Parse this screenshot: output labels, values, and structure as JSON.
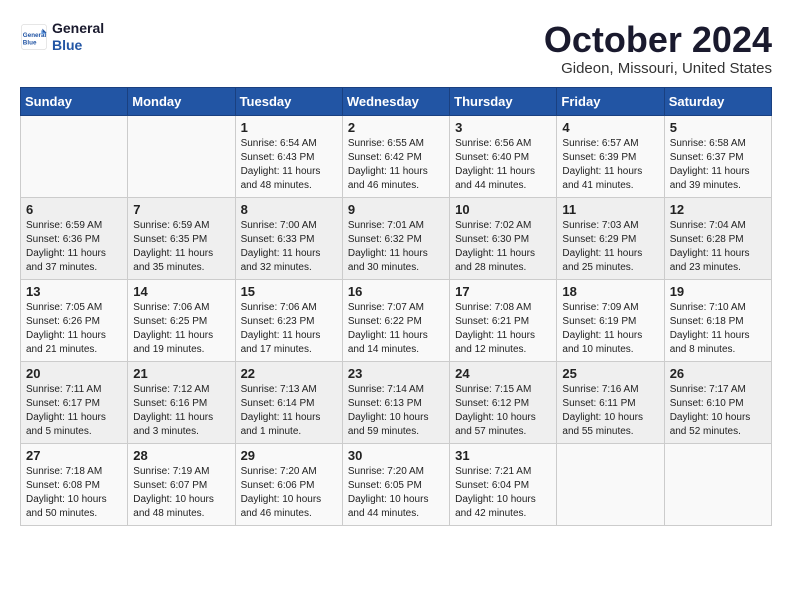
{
  "logo": {
    "line1": "General",
    "line2": "Blue"
  },
  "title": "October 2024",
  "location": "Gideon, Missouri, United States",
  "days_of_week": [
    "Sunday",
    "Monday",
    "Tuesday",
    "Wednesday",
    "Thursday",
    "Friday",
    "Saturday"
  ],
  "weeks": [
    [
      {
        "day": "",
        "content": ""
      },
      {
        "day": "",
        "content": ""
      },
      {
        "day": "1",
        "content": "Sunrise: 6:54 AM\nSunset: 6:43 PM\nDaylight: 11 hours and 48 minutes."
      },
      {
        "day": "2",
        "content": "Sunrise: 6:55 AM\nSunset: 6:42 PM\nDaylight: 11 hours and 46 minutes."
      },
      {
        "day": "3",
        "content": "Sunrise: 6:56 AM\nSunset: 6:40 PM\nDaylight: 11 hours and 44 minutes."
      },
      {
        "day": "4",
        "content": "Sunrise: 6:57 AM\nSunset: 6:39 PM\nDaylight: 11 hours and 41 minutes."
      },
      {
        "day": "5",
        "content": "Sunrise: 6:58 AM\nSunset: 6:37 PM\nDaylight: 11 hours and 39 minutes."
      }
    ],
    [
      {
        "day": "6",
        "content": "Sunrise: 6:59 AM\nSunset: 6:36 PM\nDaylight: 11 hours and 37 minutes."
      },
      {
        "day": "7",
        "content": "Sunrise: 6:59 AM\nSunset: 6:35 PM\nDaylight: 11 hours and 35 minutes."
      },
      {
        "day": "8",
        "content": "Sunrise: 7:00 AM\nSunset: 6:33 PM\nDaylight: 11 hours and 32 minutes."
      },
      {
        "day": "9",
        "content": "Sunrise: 7:01 AM\nSunset: 6:32 PM\nDaylight: 11 hours and 30 minutes."
      },
      {
        "day": "10",
        "content": "Sunrise: 7:02 AM\nSunset: 6:30 PM\nDaylight: 11 hours and 28 minutes."
      },
      {
        "day": "11",
        "content": "Sunrise: 7:03 AM\nSunset: 6:29 PM\nDaylight: 11 hours and 25 minutes."
      },
      {
        "day": "12",
        "content": "Sunrise: 7:04 AM\nSunset: 6:28 PM\nDaylight: 11 hours and 23 minutes."
      }
    ],
    [
      {
        "day": "13",
        "content": "Sunrise: 7:05 AM\nSunset: 6:26 PM\nDaylight: 11 hours and 21 minutes."
      },
      {
        "day": "14",
        "content": "Sunrise: 7:06 AM\nSunset: 6:25 PM\nDaylight: 11 hours and 19 minutes."
      },
      {
        "day": "15",
        "content": "Sunrise: 7:06 AM\nSunset: 6:23 PM\nDaylight: 11 hours and 17 minutes."
      },
      {
        "day": "16",
        "content": "Sunrise: 7:07 AM\nSunset: 6:22 PM\nDaylight: 11 hours and 14 minutes."
      },
      {
        "day": "17",
        "content": "Sunrise: 7:08 AM\nSunset: 6:21 PM\nDaylight: 11 hours and 12 minutes."
      },
      {
        "day": "18",
        "content": "Sunrise: 7:09 AM\nSunset: 6:19 PM\nDaylight: 11 hours and 10 minutes."
      },
      {
        "day": "19",
        "content": "Sunrise: 7:10 AM\nSunset: 6:18 PM\nDaylight: 11 hours and 8 minutes."
      }
    ],
    [
      {
        "day": "20",
        "content": "Sunrise: 7:11 AM\nSunset: 6:17 PM\nDaylight: 11 hours and 5 minutes."
      },
      {
        "day": "21",
        "content": "Sunrise: 7:12 AM\nSunset: 6:16 PM\nDaylight: 11 hours and 3 minutes."
      },
      {
        "day": "22",
        "content": "Sunrise: 7:13 AM\nSunset: 6:14 PM\nDaylight: 11 hours and 1 minute."
      },
      {
        "day": "23",
        "content": "Sunrise: 7:14 AM\nSunset: 6:13 PM\nDaylight: 10 hours and 59 minutes."
      },
      {
        "day": "24",
        "content": "Sunrise: 7:15 AM\nSunset: 6:12 PM\nDaylight: 10 hours and 57 minutes."
      },
      {
        "day": "25",
        "content": "Sunrise: 7:16 AM\nSunset: 6:11 PM\nDaylight: 10 hours and 55 minutes."
      },
      {
        "day": "26",
        "content": "Sunrise: 7:17 AM\nSunset: 6:10 PM\nDaylight: 10 hours and 52 minutes."
      }
    ],
    [
      {
        "day": "27",
        "content": "Sunrise: 7:18 AM\nSunset: 6:08 PM\nDaylight: 10 hours and 50 minutes."
      },
      {
        "day": "28",
        "content": "Sunrise: 7:19 AM\nSunset: 6:07 PM\nDaylight: 10 hours and 48 minutes."
      },
      {
        "day": "29",
        "content": "Sunrise: 7:20 AM\nSunset: 6:06 PM\nDaylight: 10 hours and 46 minutes."
      },
      {
        "day": "30",
        "content": "Sunrise: 7:20 AM\nSunset: 6:05 PM\nDaylight: 10 hours and 44 minutes."
      },
      {
        "day": "31",
        "content": "Sunrise: 7:21 AM\nSunset: 6:04 PM\nDaylight: 10 hours and 42 minutes."
      },
      {
        "day": "",
        "content": ""
      },
      {
        "day": "",
        "content": ""
      }
    ]
  ]
}
